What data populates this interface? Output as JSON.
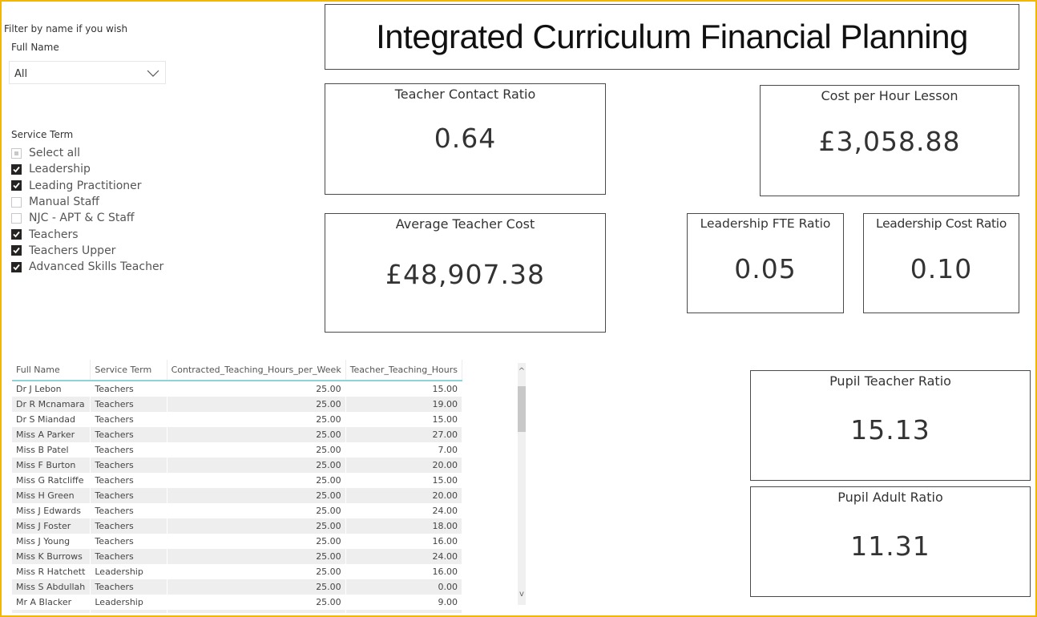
{
  "title": "Integrated Curriculum Financial Planning",
  "theme": {
    "frame_color": "#f2b705",
    "header_underline": "#8fd3d8",
    "checkbox_checked": "#252423"
  },
  "filters": {
    "hint": "Filter by name if you wish",
    "full_name": {
      "label": "Full Name",
      "selected": "All",
      "icon": "chevron-down-icon"
    },
    "service_term": {
      "label": "Service Term",
      "items": [
        {
          "label": "Select all",
          "state": "partial"
        },
        {
          "label": "Leadership",
          "state": "checked"
        },
        {
          "label": "Leading Practitioner",
          "state": "checked"
        },
        {
          "label": "Manual Staff",
          "state": "unchecked"
        },
        {
          "label": "NJC - APT & C Staff",
          "state": "unchecked"
        },
        {
          "label": "Teachers",
          "state": "checked"
        },
        {
          "label": "Teachers Upper",
          "state": "checked"
        },
        {
          "label": "Advanced Skills Teacher",
          "state": "checked"
        }
      ]
    }
  },
  "cards": {
    "teacher_contact_ratio": {
      "title": "Teacher Contact Ratio",
      "value": "0.64"
    },
    "cost_per_hour_lesson": {
      "title": "Cost per Hour Lesson",
      "value": "£3,058.88"
    },
    "average_teacher_cost": {
      "title": "Average Teacher Cost",
      "value": "£48,907.38"
    },
    "leadership_fte_ratio": {
      "title": "Leadership FTE Ratio",
      "value": "0.05"
    },
    "leadership_cost_ratio": {
      "title": "Leadership Cost Ratio",
      "value": "0.10"
    },
    "pupil_teacher_ratio": {
      "title": "Pupil Teacher Ratio",
      "value": "15.13"
    },
    "pupil_adult_ratio": {
      "title": "Pupil Adult Ratio",
      "value": "11.31"
    }
  },
  "table": {
    "columns": [
      "Full Name",
      "Service Term",
      "Contracted_Teaching_Hours_per_Week",
      "Teacher_Teaching_Hours"
    ],
    "rows": [
      [
        "Dr J Lebon",
        "Teachers",
        "25.00",
        "15.00"
      ],
      [
        "Dr R Mcnamara",
        "Teachers",
        "25.00",
        "19.00"
      ],
      [
        "Dr S Miandad",
        "Teachers",
        "25.00",
        "15.00"
      ],
      [
        "Miss A Parker",
        "Teachers",
        "25.00",
        "27.00"
      ],
      [
        "Miss B Patel",
        "Teachers",
        "25.00",
        "7.00"
      ],
      [
        "Miss F Burton",
        "Teachers",
        "25.00",
        "20.00"
      ],
      [
        "Miss G Ratcliffe",
        "Teachers",
        "25.00",
        "15.00"
      ],
      [
        "Miss H Green",
        "Teachers",
        "25.00",
        "20.00"
      ],
      [
        "Miss J Edwards",
        "Teachers",
        "25.00",
        "24.00"
      ],
      [
        "Miss J Foster",
        "Teachers",
        "25.00",
        "18.00"
      ],
      [
        "Miss J Young",
        "Teachers",
        "25.00",
        "16.00"
      ],
      [
        "Miss K Burrows",
        "Teachers",
        "25.00",
        "24.00"
      ],
      [
        "Miss R Hatchett",
        "Leadership",
        "25.00",
        "16.00"
      ],
      [
        "Miss S Abdullah",
        "Teachers",
        "25.00",
        "0.00"
      ],
      [
        "Mr A Blacker",
        "Leadership",
        "25.00",
        "9.00"
      ]
    ],
    "scroll": {
      "up_glyph": "^",
      "down_glyph": "v"
    }
  }
}
